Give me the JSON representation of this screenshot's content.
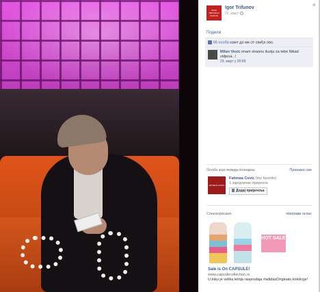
{
  "viewer": {
    "close_glyph": "×"
  },
  "photo": {
    "alt_icon": "photo"
  },
  "post": {
    "author_name": "Igor Trifunov",
    "avatar_text": "IGOR TRIFUNOV MAGIJA",
    "date": "22. март",
    "share_label": "Подели",
    "likes_text_prefix": "",
    "likes_link": "65 особа",
    "likes_suffix": " каже да им се свиђа ово.",
    "comment": {
      "author": "Milan Vexic",
      "text": "imam strasnu iluziju za tebe Nikad vidjena...!",
      "date": "23. март у 00:59"
    }
  },
  "pymk": {
    "title": "Особе које можда познаjеш",
    "see_all": "Прикажи све",
    "person": {
      "name": "Fatimaa Covic",
      "note": "(my favorite)",
      "mutual": "1 заједнички пријатељ",
      "add_label": "Додај пријатеља",
      "avatar_text": "FATIMAA COVIC"
    }
  },
  "ads": {
    "title": "Спонзорисано",
    "create": "Направи оглас",
    "item": {
      "image_text": "HOT SALE",
      "headline": "Sale is On CAPSULE!",
      "url": "www.capsulecollection.rs",
      "description": "U toku je velika letnja rasprodaja #adidasOriginals kolekcije!"
    }
  }
}
